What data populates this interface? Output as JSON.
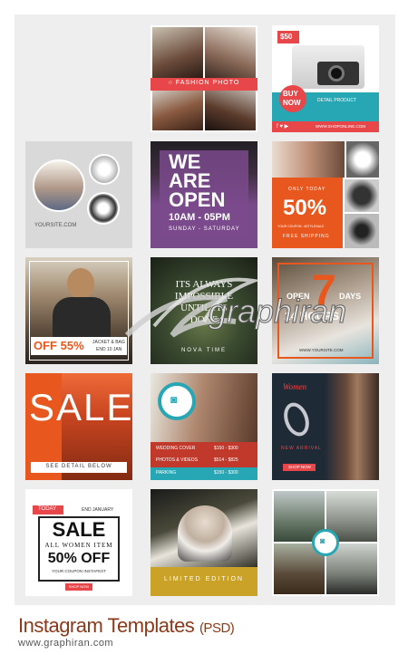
{
  "caption": {
    "title": "Instagram Templates",
    "suffix": "(PSD)",
    "url": "www.graphiran.com"
  },
  "watermark": {
    "text": "graphiran"
  },
  "t1": {
    "banner": "○ FASHION PHOTO"
  },
  "t2": {
    "price": "$50",
    "badge_line1": "BUY",
    "badge_line2": "NOW",
    "detail": "DETAIL PRODUCT",
    "url": "WWW.SHOPONLINE.COM"
  },
  "t3": {
    "site": "YOURSITE.COM"
  },
  "t4": {
    "line1": "WE",
    "line2": "ARE",
    "line3": "OPEN",
    "hours": "10AM - 05PM",
    "days": "SUNDAY - SATURDAY"
  },
  "t5": {
    "only": "ONLY TODAY",
    "percent": "50%",
    "code": "YOUR COUPON : #STYLESALE",
    "shipping": "FREE SHIPPING"
  },
  "t6": {
    "off": "OFF 55%",
    "sub1": "JACKET & BAG",
    "sub2": "END 10 JAN"
  },
  "t7": {
    "line1": "ITS ALWAYS",
    "line2": "IMPOSSIBLE",
    "line3": "UNTIL ITS",
    "line4": "DONE",
    "footer": "NOVA TIME"
  },
  "t8": {
    "open": "OPEN",
    "number": "7",
    "days": "DAYS",
    "hours": "24 HOURS",
    "url": "WWW.YOURSITE.COM"
  },
  "t9": {
    "sale": "SALE",
    "detail": "SEE DETAIL BELOW"
  },
  "t10": {
    "rows": [
      {
        "name": "WEDDING COVER",
        "price": "$150 - $300"
      },
      {
        "name": "PHOTOS & VIDEOS",
        "price": "$514 - $825"
      },
      {
        "name": "PARKING",
        "price": "$150 - $300"
      }
    ]
  },
  "t11": {
    "label": "Women",
    "arrival": "NEW ARRIVAL",
    "shop": "SHOP NOW"
  },
  "t12": {
    "today": "TODAY",
    "end": "END JANUARY",
    "sale": "SALE",
    "women": "ALL WOMEN ITEM",
    "off": "50% OFF",
    "code": "YOUR COUPON INSTAFEST",
    "shop": "SHOP NOW"
  },
  "t13": {
    "limited": "LIMITED EDITION"
  },
  "colors": {
    "orange": "#e8571e",
    "purple": "#7a4a8c",
    "teal": "#27a6b4",
    "red": "#e8474a",
    "gold": "#c9a227"
  }
}
